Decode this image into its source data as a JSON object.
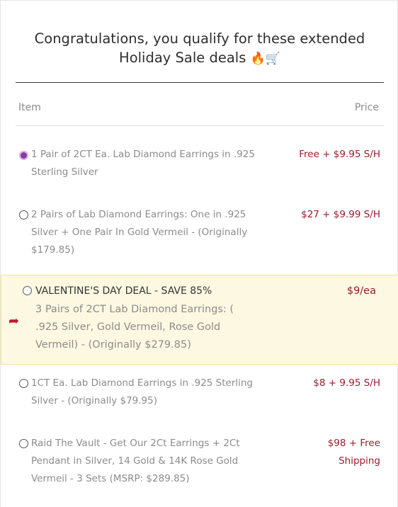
{
  "header": {
    "title_line1": "Congratulations, you qualify for these extended",
    "title_line2": "Holiday Sale deals",
    "title_emojis": "🔥🛒"
  },
  "table": {
    "col_item": "Item",
    "col_price": "Price"
  },
  "offers": [
    {
      "selected": true,
      "line1": "1 Pair of 2CT Ea. Lab Diamond Earrings in .925",
      "line2": "Sterling Silver",
      "price": "Free + $9.95 S/H"
    },
    {
      "selected": false,
      "line1": "2 Pairs of Lab Diamond Earrings: One in .925",
      "line2": "Silver + One Pair In Gold Vermeil - (Originally",
      "line3": "$179.85)",
      "price": "$27 + $9.99 S/H"
    },
    {
      "selected": false,
      "featured": true,
      "headline": "VALENTINE'S DAY DEAL - SAVE 85%",
      "line1": "3 Pairs of 2CT Lab Diamond Earrings: (",
      "line2": ".925 Silver, Gold Vermeil, Rose Gold",
      "line3": "Vermeil) - (Originally $279.85)",
      "price": "$9/ea"
    },
    {
      "selected": false,
      "line1": "1CT Ea. Lab Diamond Earrings in .925 Sterling",
      "line2": "Silver - (Originally $79.95)",
      "price": "$8 + 9.95 S/H"
    },
    {
      "selected": false,
      "line1": "Raid The Vault - Get Our 2Ct Earrings + 2Ct",
      "line2": "Pendant in Silver, 14 Gold & 14K Rose Gold",
      "line3": "Vermeil - 3 Sets (MSRP: $289.85)",
      "price_line1": "$98 + Free",
      "price_line2": "Shipping"
    }
  ],
  "colors": {
    "price": "#9b1b2e",
    "featured_bg": "#fdf8e1",
    "selected_radio": "#8b3aa6"
  }
}
